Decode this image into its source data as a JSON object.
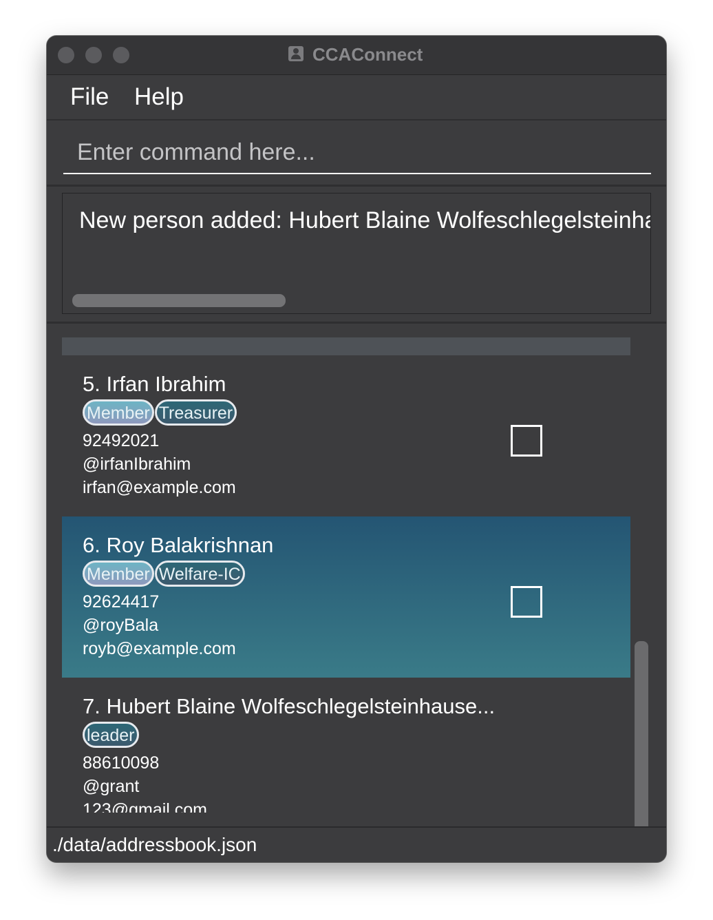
{
  "window": {
    "title": "CCAConnect"
  },
  "menu": {
    "file_label": "File",
    "help_label": "Help"
  },
  "command": {
    "placeholder": "Enter command here...",
    "value": ""
  },
  "result": {
    "message": "New person added: Hubert Blaine Wolfeschlegelsteinhausenbergerdorff"
  },
  "persons": [
    {
      "name": "5. Irfan Ibrahim",
      "tags": [
        "Member",
        "Treasurer"
      ],
      "phone": "92492021",
      "telegram": "@irfanIbrahim",
      "email": "irfan@example.com",
      "selected": false
    },
    {
      "name": "6. Roy Balakrishnan",
      "tags": [
        "Member",
        "Welfare-IC"
      ],
      "phone": "92624417",
      "telegram": "@royBala",
      "email": "royb@example.com",
      "selected": true
    },
    {
      "name": "7. Hubert Blaine Wolfeschlegelsteinhause...",
      "tags": [
        "leader"
      ],
      "phone": "88610098",
      "telegram": "@grant",
      "email": "123@gmail.com",
      "selected": false
    }
  ],
  "status": {
    "file_path": "./data/addressbook.json"
  },
  "colors": {
    "window_bg": "#3c3c3e",
    "selected_card_top": "#245573",
    "selected_card_bottom": "#3a7b88",
    "tag_member": "#6db4c4",
    "tag_role": "#2d6776"
  },
  "icons": {
    "app": "person-card-icon"
  }
}
